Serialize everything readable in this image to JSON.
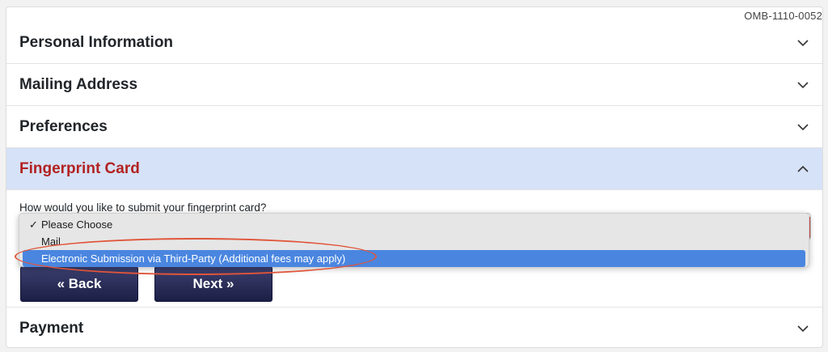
{
  "form_id": "OMB-1110-0052",
  "sections": [
    {
      "label": "Personal Information",
      "expanded": false
    },
    {
      "label": "Mailing Address",
      "expanded": false
    },
    {
      "label": "Preferences",
      "expanded": false
    },
    {
      "label": "Fingerprint Card",
      "expanded": true
    },
    {
      "label": "Payment",
      "expanded": false
    }
  ],
  "fingerprint": {
    "question": "How would you like to submit your fingerprint card?",
    "options": [
      {
        "label": "Please Choose",
        "checked": true
      },
      {
        "label": "Mail",
        "checked": false
      },
      {
        "label": "Electronic Submission via Third-Party (Additional fees may apply)",
        "highlighted": true
      }
    ],
    "check_mark": "✓"
  },
  "buttons": {
    "back": "« Back",
    "next": "Next »"
  },
  "colors": {
    "active_header_bg": "#d6e2f7",
    "active_header_text": "#b22222",
    "button_bg": "#1c1f45",
    "highlight": "#4a86e0",
    "annotation": "#e0553a"
  },
  "icons": {
    "collapsed": "chevron-down-icon",
    "expanded": "chevron-up-icon"
  }
}
